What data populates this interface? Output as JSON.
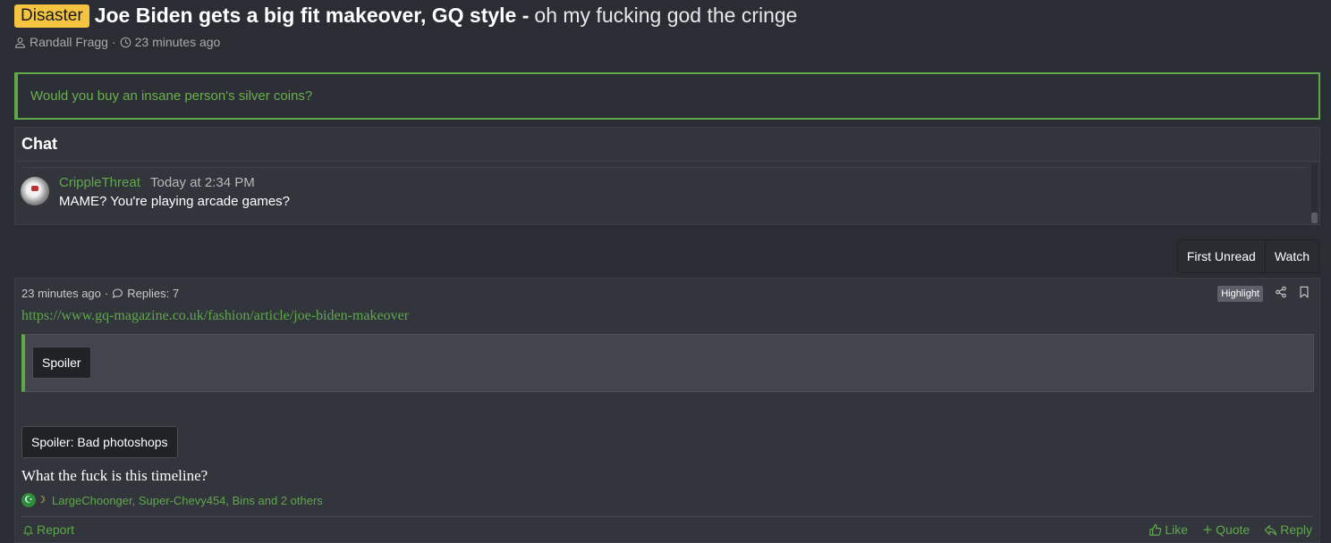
{
  "thread": {
    "prefix": "Disaster",
    "title_bold": "Joe Biden gets a big fit makeover, GQ style -",
    "title_rest": "oh my fucking god the cringe",
    "author": "Randall Fragg",
    "separator": "·",
    "time_ago": "23 minutes ago"
  },
  "notice": {
    "text": "Would you buy an insane person's silver coins?"
  },
  "chat": {
    "title": "Chat",
    "messages": [
      {
        "user": "CrippleThreat",
        "time": "Today at 2:34 PM",
        "text": "MAME? You're playing arcade games?"
      }
    ]
  },
  "thread_buttons": {
    "first_unread": "First Unread",
    "watch": "Watch"
  },
  "post": {
    "time_ago": "23 minutes ago",
    "separator": "·",
    "replies": "Replies: 7",
    "highlight": "Highlight",
    "link": "https://www.gq-magazine.co.uk/fashion/article/joe-biden-makeover",
    "spoiler_1": "Spoiler",
    "spoiler_2": "Spoiler: Bad photoshops",
    "body": "What the fuck is this timeline?",
    "reactions": "LargeChoonger, Super-Chevy454, Bins and 2 others",
    "report": "Report",
    "like": "Like",
    "quote": "Quote",
    "reply": "Reply"
  },
  "colors": {
    "background": "#2a2d33",
    "accent_green": "#5fa84a",
    "prefix_yellow": "#f5c542"
  }
}
